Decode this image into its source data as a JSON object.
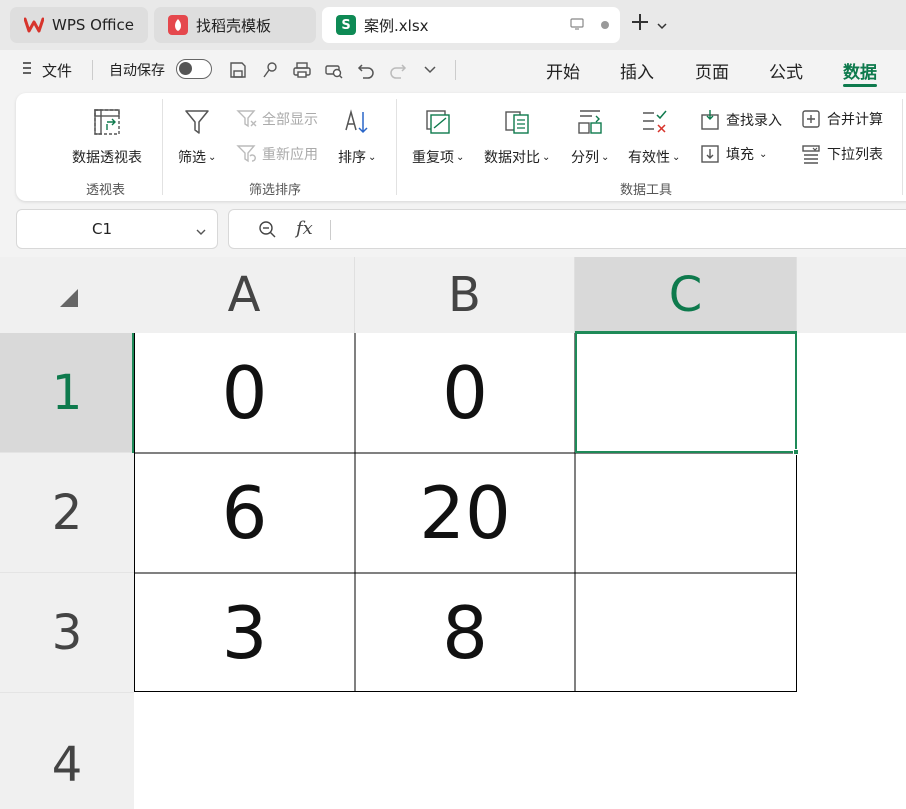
{
  "tabs": [
    {
      "label": "WPS Office",
      "icon": "wps-logo-icon",
      "color": "#d7342c"
    },
    {
      "label": "找稻壳模板",
      "icon": "daoke-icon",
      "color": "#e5484d"
    },
    {
      "label": "案例.xlsx",
      "icon": "spreadsheet-s-icon",
      "color": "#0e8a55"
    }
  ],
  "menu": {
    "file_label": "文件",
    "autosave_label": "自动保存",
    "ribbon_tabs": [
      "开始",
      "插入",
      "页面",
      "公式",
      "数据"
    ],
    "active_tab": "数据"
  },
  "ribbon": {
    "pivot_label": "数据透视表",
    "pivot_group": "透视表",
    "filter_label": "筛选",
    "show_all_label": "全部显示",
    "reapply_label": "重新应用",
    "sort_label": "排序",
    "filter_group": "筛选排序",
    "dup_label": "重复项",
    "compare_label": "数据对比",
    "split_label": "分列",
    "validity_label": "有效性",
    "lookup_label": "查找录入",
    "fill_label": "填充",
    "merge_calc_label": "合并计算",
    "dropdown_list_label": "下拉列表",
    "tools_group": "数据工具"
  },
  "formula_bar": {
    "cell_ref": "C1",
    "fx_label": "fx",
    "content": ""
  },
  "sheet": {
    "columns": [
      "A",
      "B",
      "C"
    ],
    "rows": [
      "1",
      "2",
      "3",
      "4"
    ],
    "active_cell": "C1",
    "cells": [
      [
        "0",
        "0",
        ""
      ],
      [
        "6",
        "20",
        ""
      ],
      [
        "3",
        "8",
        ""
      ]
    ]
  },
  "colors": {
    "accent": "#0e7a4d",
    "selection": "#1e8a58"
  }
}
